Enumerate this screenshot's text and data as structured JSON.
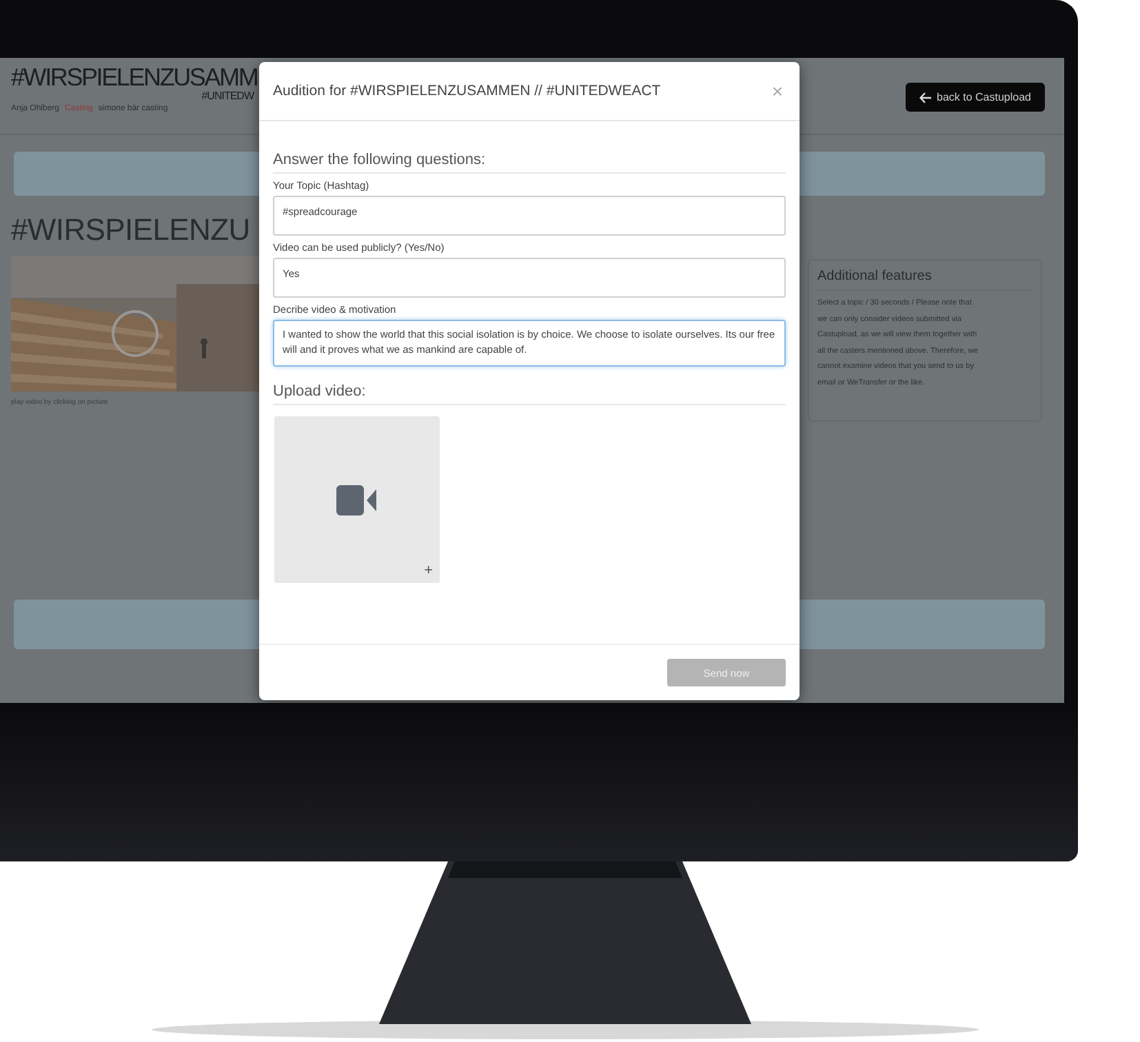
{
  "page": {
    "title": "#WIRSPIELENZUSAMM",
    "subtitle": "#UNITEDW",
    "credits": [
      {
        "text": "Anja Ohlberg",
        "kind": "plain"
      },
      {
        "text": "Casting",
        "kind": "accent"
      },
      {
        "text": "simone bär casting",
        "kind": "plain"
      }
    ],
    "back_button": "back to Castupload",
    "heading": "#WIRSPIELENZU",
    "video_caption": "play video by clicking on picture",
    "features": {
      "title": "Additional features",
      "lines": [
        "Select a topic / 30 seconds / Please note that",
        "we can only consider videos submitted via",
        "Castupload, as we will view them together with",
        "all the casters mentioned above. Therefore, we",
        "cannot examine videos that you send to us by",
        "email or WeTransfer or the like."
      ]
    }
  },
  "modal": {
    "title": "Audition for #WIRSPIELENZUSAMMEN // #UNITEDWEACT",
    "close": "×",
    "section": "Answer the following questions:",
    "fields": [
      {
        "label": "Your Topic (Hashtag)",
        "value": "#spreadcourage",
        "focused": false
      },
      {
        "label": "Video can be used publicly? (Yes/No)",
        "value": "Yes",
        "focused": false
      },
      {
        "label": "Decribe video & motivation",
        "value": "I wanted to show the world that this social isolation is by choice. We choose to isolate ourselves. Its our free will and it proves what we as mankind are capable of.",
        "focused": true
      }
    ],
    "upload_title": "Upload video:",
    "upload_plus": "+",
    "send": "Send now",
    "send_disabled": true
  }
}
